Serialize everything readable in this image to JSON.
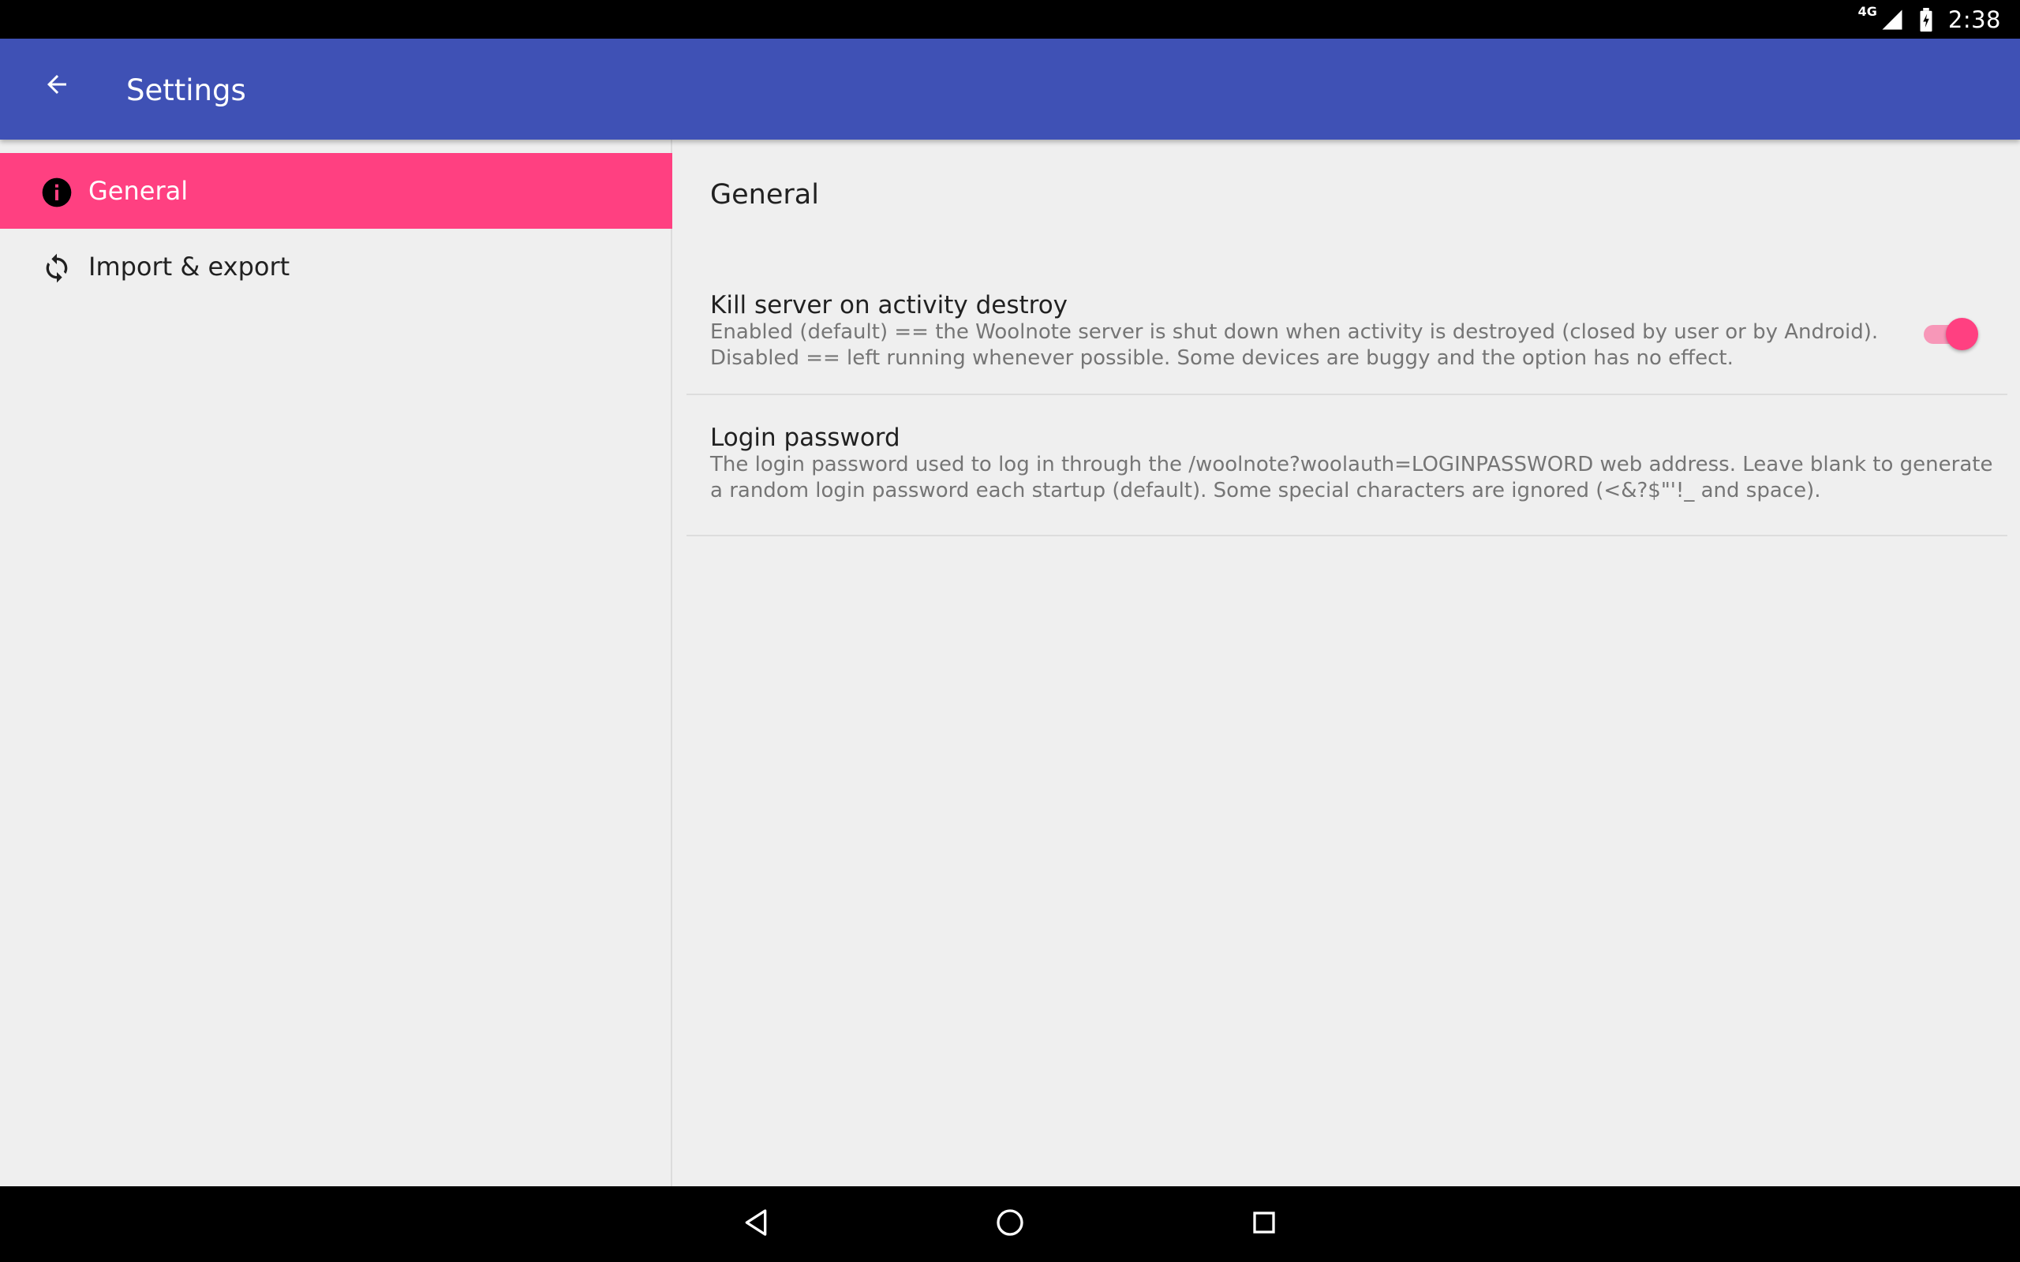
{
  "status_bar": {
    "network": "4G",
    "time": "2:38"
  },
  "app_bar": {
    "title": "Settings",
    "back_icon": "arrow-back-icon"
  },
  "headers": [
    {
      "label": "General",
      "icon": "info-icon",
      "selected": true
    },
    {
      "label": "Import & export",
      "icon": "sync-icon",
      "selected": false
    }
  ],
  "general": {
    "title": "General",
    "preferences": [
      {
        "title": "Kill server on activity destroy",
        "summary": "Enabled (default) == the Woolnote server is shut down when activity is destroyed (closed by user or by Android).\nDisabled == left running whenever possible. Some devices are buggy and the option has no effect.",
        "type": "switch",
        "checked": true
      },
      {
        "title": "Login password",
        "summary": "The login password used to log in through the /woolnote?woolauth=LOGINPASSWORD web address. Leave blank to generate a random login password each startup (default). Some special characters are ignored (<&?$\"'!_ and space).",
        "type": "text"
      }
    ]
  },
  "nav_bar": {
    "buttons": [
      "nav-back-icon",
      "nav-home-icon",
      "nav-recents-icon"
    ]
  },
  "colors": {
    "primary": "#3f51b5",
    "accent": "#ff4081",
    "background": "#efefef"
  }
}
